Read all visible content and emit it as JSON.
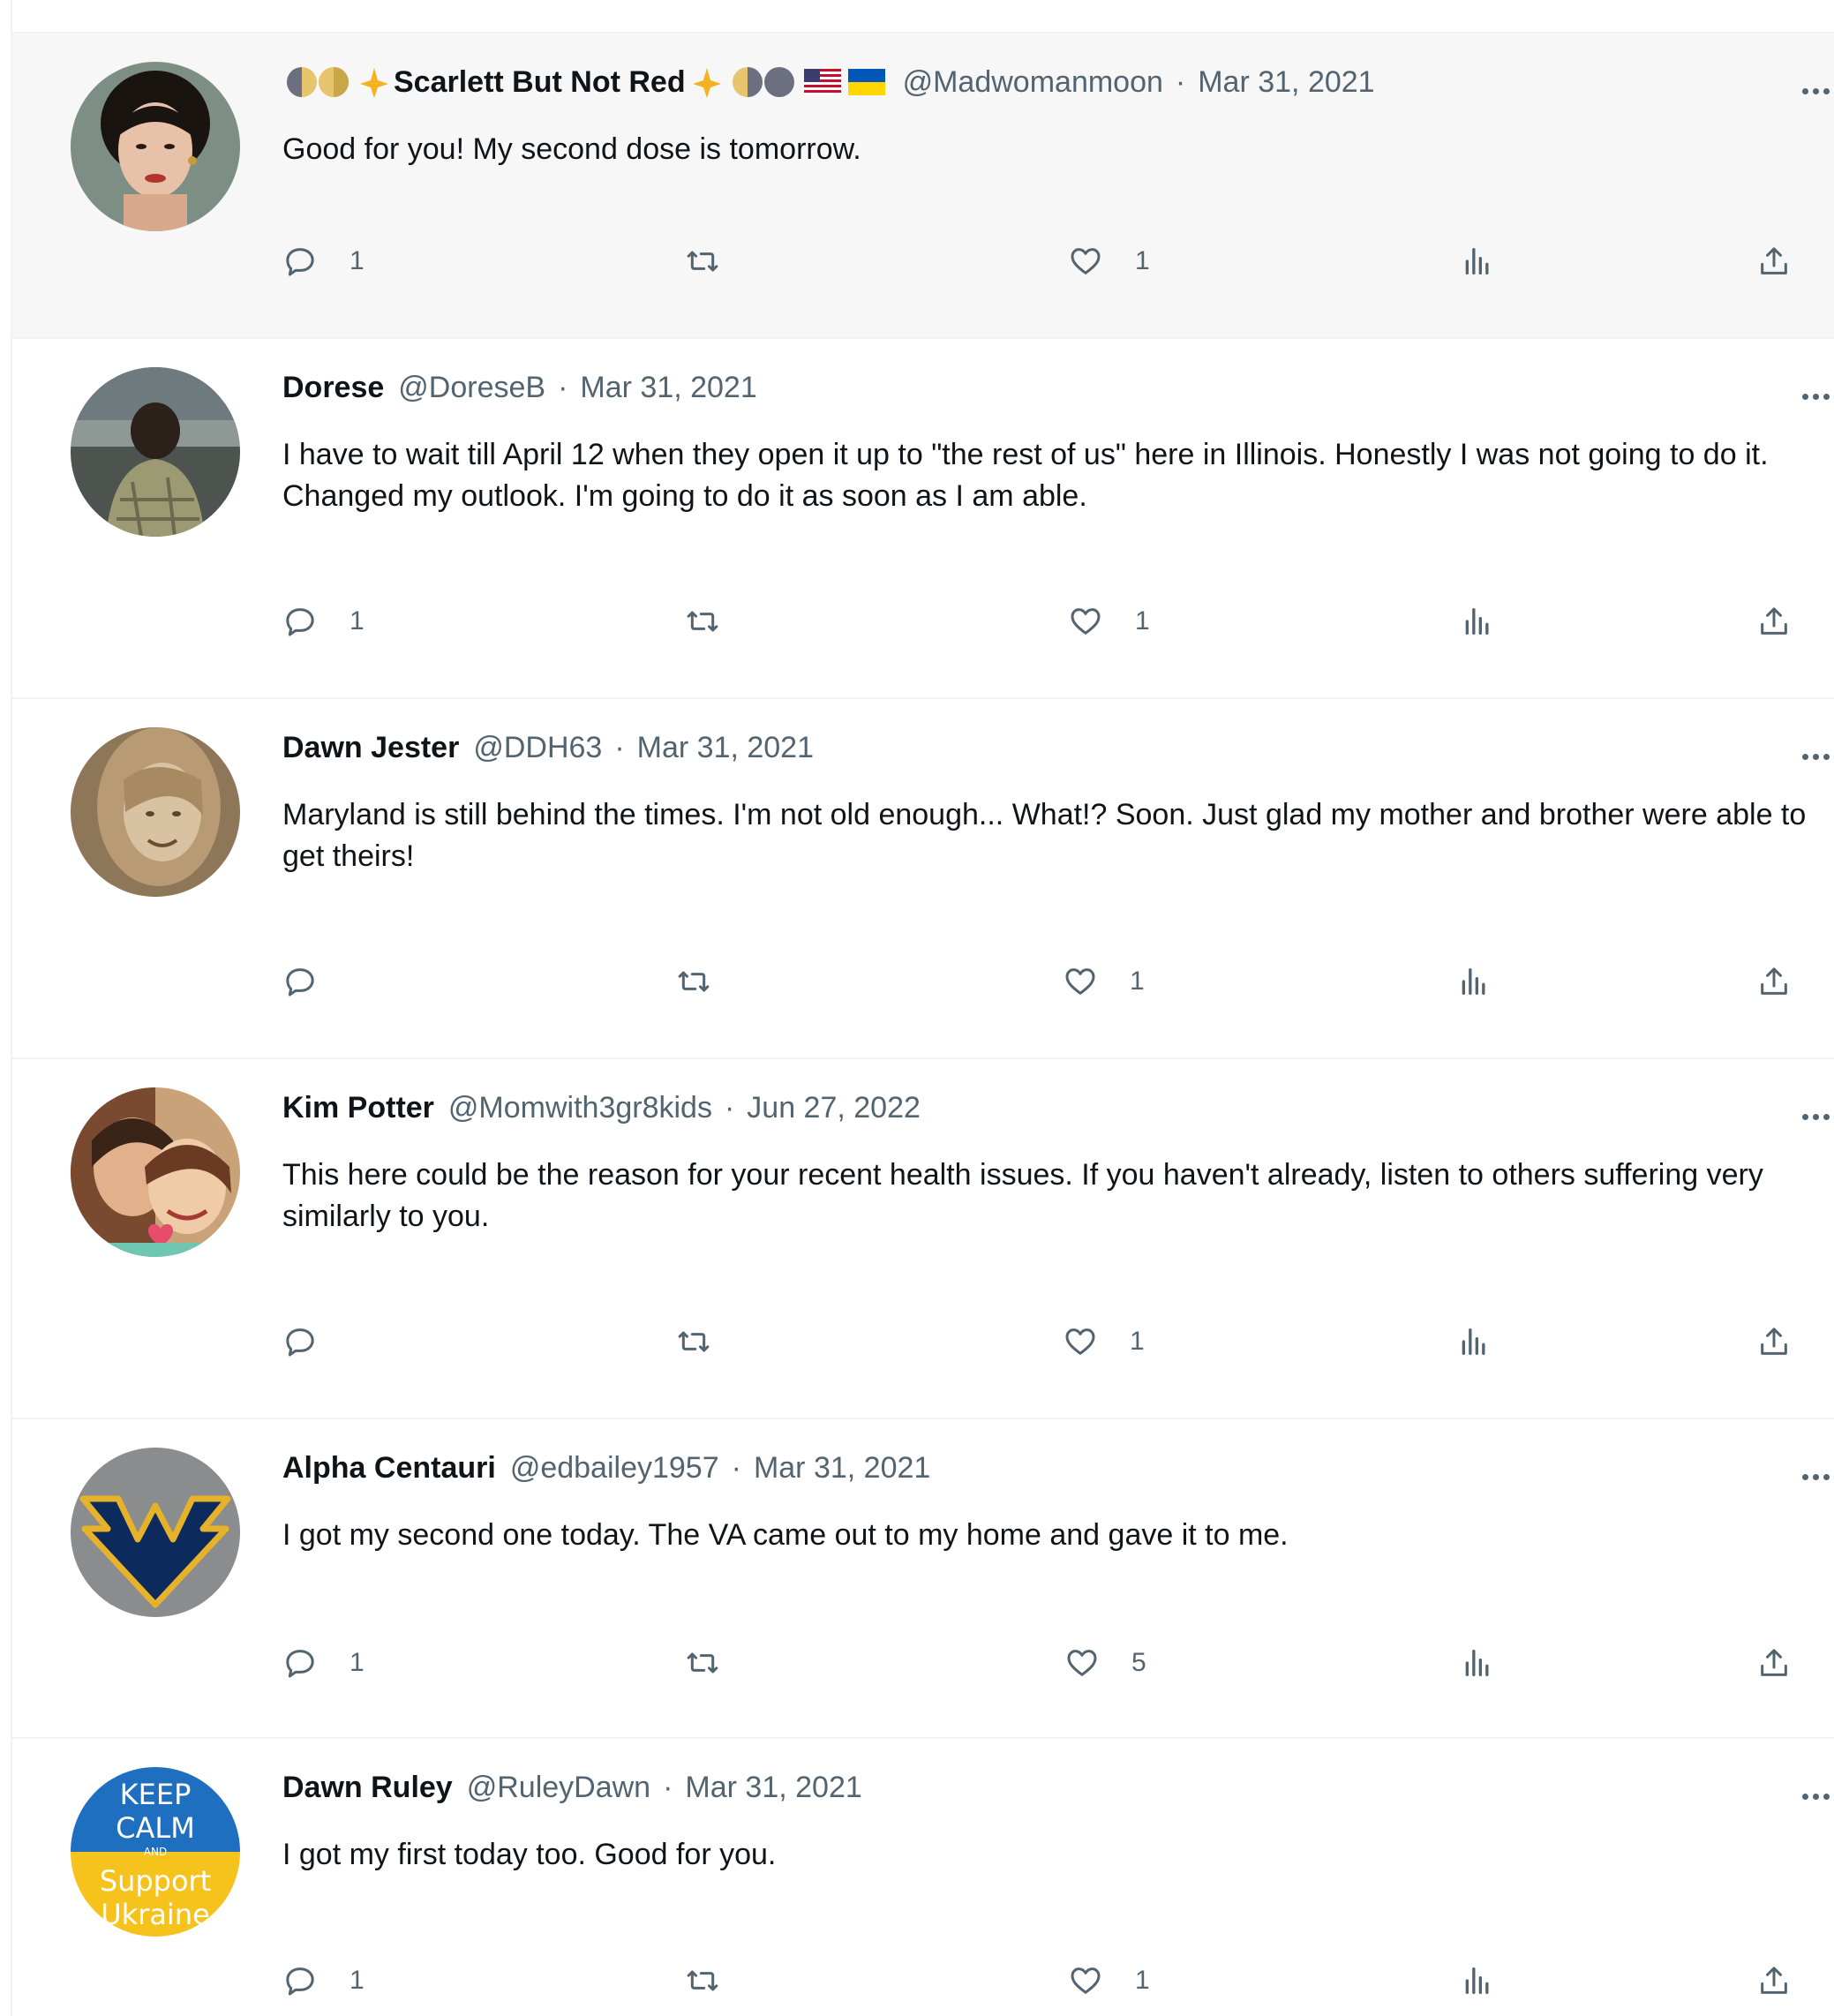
{
  "tweets": [
    {
      "name": "Scarlett But Not Red",
      "handle": "@Madwomanmoon",
      "sep": "·",
      "date": "Mar 31, 2021",
      "text": "Good for you! My second dose is tomorrow.",
      "replies": "1",
      "reposts": "",
      "likes": "1",
      "avatar": "portrait-dark-hair",
      "highlighted": true
    },
    {
      "name": "Dorese",
      "handle": "@DoreseB",
      "sep": "·",
      "date": "Mar 31, 2021",
      "text": "I have to wait till April 12 when they open it up to \"the rest of us\" here in Illinois.  Honestly I was not going to do it. Changed my outlook. I'm going to do it as soon as I am able.",
      "replies": "1",
      "reposts": "",
      "likes": "1",
      "avatar": "person-outdoors"
    },
    {
      "name": "Dawn Jester",
      "handle": "@DDH63",
      "sep": "·",
      "date": "Mar 31, 2021",
      "text": "Maryland is still behind the times. I'm not old enough... What!? Soon. Just glad my mother and brother were able to get theirs!",
      "replies": "",
      "reposts": "",
      "likes": "1",
      "avatar": "sepia-portrait"
    },
    {
      "name": "Kim Potter",
      "handle": "@Momwith3gr8kids",
      "sep": "·",
      "date": "Jun 27, 2022",
      "text": "This here could be the reason for your recent health issues.  If you haven't already, listen to others suffering very similarly to you.",
      "replies": "",
      "reposts": "",
      "likes": "1",
      "avatar": "painted-portrait"
    },
    {
      "name": "Alpha Centauri",
      "handle": "@edbailey1957",
      "sep": "·",
      "date": "Mar 31, 2021",
      "text": "I got my second one today. The VA came out to my home and gave it to me.",
      "replies": "1",
      "reposts": "",
      "likes": "5",
      "avatar": "wv-logo"
    },
    {
      "name": "Dawn Ruley",
      "handle": "@RuleyDawn",
      "sep": "·",
      "date": "Mar 31, 2021",
      "text": "I got my first today too. Good for you.",
      "replies": "1",
      "reposts": "",
      "likes": "1",
      "avatar": "keep-calm-poster",
      "avatar_text": [
        "KEEP",
        "CALM",
        "AND",
        "Support",
        "Ukraine"
      ]
    }
  ],
  "icons": {
    "reply": "reply-icon",
    "repost": "repost-icon",
    "like": "heart-icon",
    "views": "views-icon",
    "share": "share-icon",
    "more": "more-icon"
  },
  "colors": {
    "text_primary": "#0f1419",
    "text_secondary": "#536471",
    "divider": "#eff3f4",
    "highlight_bg": "#f7f7f7"
  }
}
